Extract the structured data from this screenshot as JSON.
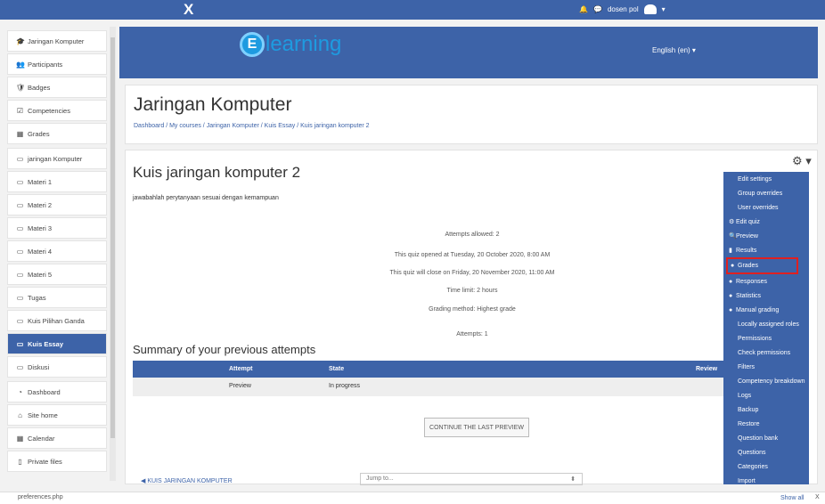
{
  "topbar": {
    "close_glyph": "X",
    "bell_icon": "🔔",
    "chat_icon": "💬",
    "user_name": "dosen pol",
    "caret": "▾"
  },
  "sidebar": {
    "items": [
      {
        "icon": "graduation-cap-icon",
        "glyph": "🎓",
        "label": "Jaringan Komputer"
      },
      {
        "icon": "users-icon",
        "glyph": "👥",
        "label": "Participants"
      },
      {
        "icon": "shield-icon",
        "glyph": "🛡",
        "label": "Badges"
      },
      {
        "icon": "check-square-icon",
        "glyph": "☑",
        "label": "Competencies"
      },
      {
        "icon": "table-icon",
        "glyph": "▦",
        "label": "Grades"
      },
      {
        "icon": "folder-icon",
        "glyph": "▭",
        "label": "jaringan Komputer"
      },
      {
        "icon": "folder-icon",
        "glyph": "▭",
        "label": "Materi 1"
      },
      {
        "icon": "folder-icon",
        "glyph": "▭",
        "label": "Materi 2"
      },
      {
        "icon": "folder-icon",
        "glyph": "▭",
        "label": "Materi 3"
      },
      {
        "icon": "folder-icon",
        "glyph": "▭",
        "label": "Materi 4"
      },
      {
        "icon": "folder-icon",
        "glyph": "▭",
        "label": "Materi 5"
      },
      {
        "icon": "folder-icon",
        "glyph": "▭",
        "label": "Tugas"
      },
      {
        "icon": "folder-icon",
        "glyph": "▭",
        "label": "Kuis Pilihan Ganda"
      },
      {
        "icon": "folder-icon",
        "glyph": "▭",
        "label": "Kuis Essay"
      },
      {
        "icon": "folder-icon",
        "glyph": "▭",
        "label": "Diskusi"
      },
      {
        "icon": "dashboard-icon",
        "glyph": "◔",
        "label": "Dashboard"
      },
      {
        "icon": "home-icon",
        "glyph": "⌂",
        "label": "Site home"
      },
      {
        "icon": "calendar-icon",
        "glyph": "▦",
        "label": "Calendar"
      },
      {
        "icon": "file-icon",
        "glyph": "▯",
        "label": "Private files"
      }
    ]
  },
  "banner": {
    "logo_letter": "E",
    "logo_word": "learning",
    "lang": "English (en) ▾"
  },
  "header": {
    "title": "Jaringan Komputer",
    "breadcrumb": "Dashboard / My courses / Jaringan Komputer / Kuis Essay / Kuis jaringan komputer 2"
  },
  "quiz": {
    "title": "Kuis jaringan komputer 2",
    "description": "jawabahlah perytanyaan sesuai dengan kemampuan",
    "info": [
      "Attempts allowed: 2",
      "This quiz opened at Tuesday, 20 October 2020, 8:00 AM",
      "This quiz will close on Friday, 20 November 2020, 11:00 AM",
      "Time limit: 2 hours",
      "Grading method: Highest grade"
    ],
    "attempts": "Attempts: 1",
    "summary_title": "Summary of your previous attempts",
    "table": {
      "headers": [
        "Attempt",
        "State",
        "Review"
      ],
      "rows": [
        [
          "Preview",
          "In progress",
          ""
        ]
      ]
    },
    "continue_button": "CONTINUE THE LAST PREVIEW",
    "prev_link": "◀ KUIS JARINGAN KOMPUTER",
    "jump_to": "Jump to...",
    "jump_caret": "⬍",
    "gear_glyph": "⚙ ▾"
  },
  "admin_menu": {
    "items": [
      {
        "label": "Edit settings",
        "bullet": ""
      },
      {
        "label": "Group overrides",
        "bullet": ""
      },
      {
        "label": "User overrides",
        "bullet": ""
      },
      {
        "label": "Edit quiz",
        "bullet": "⚙"
      },
      {
        "label": "Preview",
        "bullet": "🔍"
      },
      {
        "label": "Results",
        "bullet": "▮"
      },
      {
        "label": "Grades",
        "bullet": "●"
      },
      {
        "label": "Responses",
        "bullet": "●"
      },
      {
        "label": "Statistics",
        "bullet": "●"
      },
      {
        "label": "Manual grading",
        "bullet": "●"
      },
      {
        "label": "Locally assigned roles",
        "bullet": ""
      },
      {
        "label": "Permissions",
        "bullet": ""
      },
      {
        "label": "Check permissions",
        "bullet": ""
      },
      {
        "label": "Filters",
        "bullet": ""
      },
      {
        "label": "Competency breakdown",
        "bullet": ""
      },
      {
        "label": "Logs",
        "bullet": ""
      },
      {
        "label": "Backup",
        "bullet": ""
      },
      {
        "label": "Restore",
        "bullet": ""
      },
      {
        "label": "Question bank",
        "bullet": ""
      },
      {
        "label": "Questions",
        "bullet": ""
      },
      {
        "label": "Categories",
        "bullet": ""
      },
      {
        "label": "Import",
        "bullet": ""
      }
    ],
    "highlight_color": "#e02020"
  },
  "download_bar": {
    "file": "preferences.php",
    "show_all": "Show all",
    "close": "X"
  },
  "colors": {
    "brand": "#3d63a8",
    "accent": "#1e9be0"
  }
}
